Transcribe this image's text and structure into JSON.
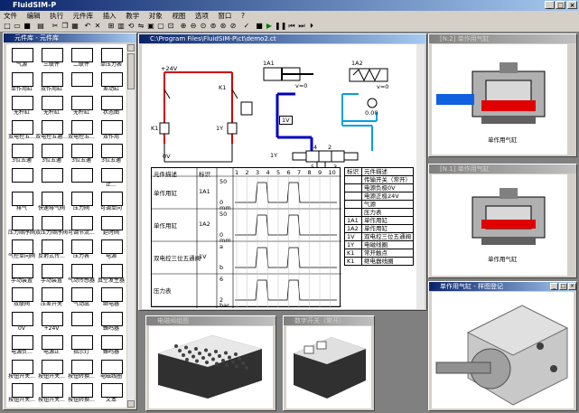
{
  "app": {
    "title": "FluidSIM-P"
  },
  "menu": [
    "文件",
    "编辑",
    "执行",
    "元件库",
    "插入",
    "教学",
    "对象",
    "视图",
    "选项",
    "窗口",
    "?"
  ],
  "toolbar": {
    "zoom_icons": [
      "zoom-in-icon",
      "zoom-out-icon",
      "zoom-fit-icon",
      "zoom-window-icon",
      "zoom-all-icon",
      "zoom-prev-icon"
    ],
    "play_icons": [
      "stop-icon",
      "play-icon",
      "pause-icon",
      "step-back-icon",
      "step-forward-icon",
      "end-icon"
    ]
  },
  "library": {
    "title": "元件库 - 元件库",
    "items": [
      [
        "气源",
        "三联件",
        "二联件",
        "单压力表"
      ],
      [
        "单作用缸",
        "双作用缸",
        "",
        "差动缸"
      ],
      [
        "无杆缸",
        "无杆缸",
        "无杆缸",
        "状态图"
      ],
      [
        "双电控五...",
        "双电控五通...",
        "双电控五...",
        "双作用"
      ],
      [
        "3位五通",
        "3位五通",
        "3位五通",
        "3位五通"
      ],
      [
        "",
        "",
        "",
        "止..."
      ],
      [
        "排气",
        "快速排气阀",
        "压力阀",
        "可调单向"
      ],
      [
        "压力顺序阀",
        "双压力顺序阀",
        "可调节流...",
        "延时阀"
      ],
      [
        "气控单向阀",
        "反射式传...",
        "压力表",
        "电源"
      ],
      [
        "手动装置",
        "手动装置",
        "气动传感器",
        "真空发生器"
      ],
      [
        "双联阀",
        "压差开关",
        "气动出",
        "继电器"
      ],
      [
        "0V",
        "+24V",
        "",
        "蜂鸣器"
      ],
      [
        "电源负...",
        "电源正",
        "指示灯",
        "蜂鸣器"
      ],
      [
        "按钮开关...",
        "按钮开关...",
        "按钮转换...",
        "电磁线圈"
      ],
      [
        "按钮开关...",
        "按钮开关...",
        "按钮转换...",
        "文本"
      ]
    ]
  },
  "main_window": {
    "title": "C:\\Program Files\\FluidSIM-P\\ct\\demo2.ct",
    "circuit": {
      "supply_plus": "+24V",
      "supply_zero": "0V",
      "cyl1": "1A1",
      "cyl2": "1A2",
      "speed1": "v=0",
      "speed2": "v=0",
      "valve": "1V",
      "coil": "1Y",
      "relay": "K1",
      "relay2": "K1",
      "pressure": "0.00",
      "coil_label": "1Y",
      "ports": [
        "4",
        "2",
        "5",
        "1",
        "3"
      ],
      "node_nums": [
        "1",
        "2"
      ]
    },
    "state_diagram": {
      "header": [
        "元件描述",
        "标识"
      ],
      "time_ticks": [
        "1",
        "2",
        "3",
        "4",
        "5",
        "6",
        "7",
        "8",
        "9",
        "10"
      ],
      "rows": [
        {
          "desc": "单作用缸",
          "id": "1A1",
          "scale_top": "50",
          "scale_bottom": "0",
          "unit": "mm"
        },
        {
          "desc": "单作用缸",
          "id": "1A2",
          "scale_top": "50",
          "scale_bottom": "0",
          "unit": "mm"
        },
        {
          "desc": "双电控三位五通阀",
          "id": "1V",
          "scale_top": "a",
          "scale_bottom": "b",
          "unit": ""
        },
        {
          "desc": "压力表",
          "id": "",
          "scale_top": "6",
          "scale_bottom": "2",
          "unit": "bar"
        }
      ]
    },
    "legend_table": {
      "header": [
        "标识",
        "元件描述"
      ],
      "rows": [
        [
          "",
          "传输开关（常开）"
        ],
        [
          "",
          "电源负极0V"
        ],
        [
          "",
          "电源正极24V"
        ],
        [
          "",
          "气源"
        ],
        [
          "",
          "压力表"
        ],
        [
          "1A1",
          "单作用缸"
        ],
        [
          "1A2",
          "单作用缸"
        ],
        [
          "1V",
          "双电控三位五通阀"
        ],
        [
          "1Y",
          "电磁线圈"
        ],
        [
          "K1",
          "常开触点"
        ],
        [
          "K1",
          "继电器线圈"
        ]
      ]
    }
  },
  "windows": {
    "w1": {
      "title": "[N.2] 单作用气缸",
      "caption": "单作用气缸"
    },
    "w2": {
      "title": "[N.1] 单作用气缸",
      "caption": "单作用气缸"
    },
    "w3": {
      "title": "单作用气缸 - 样图登记"
    },
    "w4": {
      "title": "电磁阀组图"
    },
    "w5": {
      "title": "数字开关（常开）"
    }
  },
  "colors": {
    "active_title": "#0a246a",
    "inactive_title": "#808080",
    "red_line": "#d00000",
    "blue_line": "#0000c0",
    "cyan_line": "#00a0e0"
  }
}
